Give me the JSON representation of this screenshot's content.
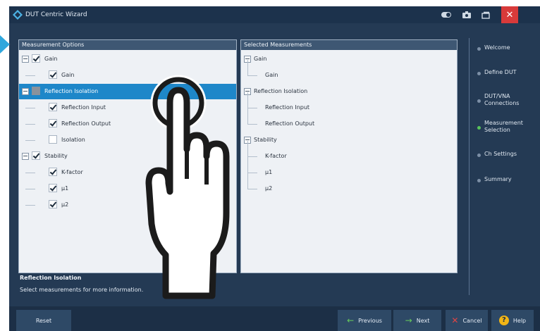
{
  "window": {
    "title": "DUT Centric Wizard"
  },
  "left_panel": {
    "header": "Measurement Options",
    "items": [
      {
        "label": "Gain",
        "level": 0,
        "check": "checked",
        "expander": true
      },
      {
        "label": "Gain",
        "level": 1,
        "check": "checked",
        "expander": false
      },
      {
        "label": "Reflection Isolation",
        "level": 0,
        "check": "partial",
        "expander": true,
        "selected": true
      },
      {
        "label": "Reflection Input",
        "level": 1,
        "check": "checked",
        "expander": false
      },
      {
        "label": "Reflection Output",
        "level": 1,
        "check": "checked",
        "expander": false
      },
      {
        "label": "Isolation",
        "level": 1,
        "check": "unchecked",
        "expander": false
      },
      {
        "label": "Stability",
        "level": 0,
        "check": "checked",
        "expander": true
      },
      {
        "label": "K-factor",
        "level": 1,
        "check": "checked",
        "expander": false
      },
      {
        "label": "µ1",
        "level": 1,
        "check": "checked",
        "expander": false
      },
      {
        "label": "µ2",
        "level": 1,
        "check": "checked",
        "expander": false
      }
    ]
  },
  "right_panel": {
    "header": "Selected Measurements",
    "items": [
      {
        "label": "Gain",
        "level": 0
      },
      {
        "label": "Gain",
        "level": 1
      },
      {
        "label": "Reflection Isolation",
        "level": 0
      },
      {
        "label": "Reflection Input",
        "level": 1
      },
      {
        "label": "Reflection Output",
        "level": 1
      },
      {
        "label": "Stability",
        "level": 0
      },
      {
        "label": "K-factor",
        "level": 1
      },
      {
        "label": "µ1",
        "level": 1
      },
      {
        "label": "µ2",
        "level": 1
      }
    ]
  },
  "info": {
    "title": "Reflection Isolation",
    "text": "Select measurements for more information."
  },
  "steps": [
    {
      "label": "Welcome",
      "active": false
    },
    {
      "label": "Define DUT",
      "active": false
    },
    {
      "label": "DUT/VNA Connections",
      "active": false
    },
    {
      "label": "Measurement Selection",
      "active": true
    },
    {
      "label": "Ch Settings",
      "active": false
    },
    {
      "label": "Summary",
      "active": false
    }
  ],
  "buttons": {
    "reset": "Reset",
    "previous": "Previous",
    "next": "Next",
    "cancel": "Cancel",
    "help": "Help"
  },
  "colors": {
    "frame": "#243a54",
    "selection": "#1e87c9",
    "accent_green": "#58c45a",
    "close_red": "#d83a3a",
    "help_yellow": "#f2b515"
  }
}
